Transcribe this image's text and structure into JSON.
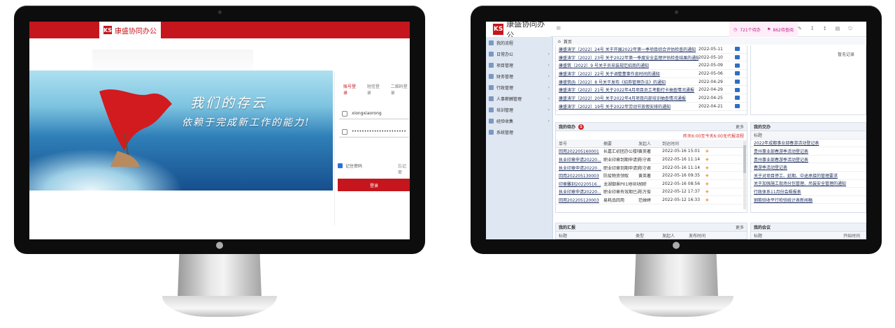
{
  "brand": {
    "name": "康盛协同办公",
    "mark": "KS"
  },
  "login": {
    "slogan1": "我们的存云",
    "slogan2": "依赖于完成新工作的能力!",
    "tabs": [
      "账号登录",
      "短信登录",
      "二维码登录"
    ],
    "username": "xiongxiaorong",
    "password_mask": "••••••••••••••••••••••",
    "remember": "记住密码",
    "forgot": "忘记密",
    "login_button": "登录"
  },
  "dashboard": {
    "header": {
      "menu_toggle": "≡",
      "todo_count": "721个待办",
      "unread_count": "862待查阅"
    },
    "sidebar": [
      {
        "label": "我的流程"
      },
      {
        "label": "日常办公"
      },
      {
        "label": "项目管理"
      },
      {
        "label": "财务管理"
      },
      {
        "label": "行政管理"
      },
      {
        "label": "人事薪酬管理"
      },
      {
        "label": "培训管理"
      },
      {
        "label": "经验收集"
      },
      {
        "label": "系统管理"
      }
    ],
    "breadcrumb": "首页",
    "notices": [
      {
        "title": "康盛涛字〔2022〕24号 关于开展2022年第一季项目综合评估检查的通知",
        "date": "2022-05-11"
      },
      {
        "title": "康盛涛字〔2022〕23号 关于2022年第一季度安全监理评估检查结果的通知",
        "date": "2022-05-10"
      },
      {
        "title": "康盛筑〔2022〕9 号关于员采装规范招商的通知",
        "date": "2022-05-09"
      },
      {
        "title": "康盛涛字〔2022〕22号 关于调整董事作息时间的通知",
        "date": "2022-05-06"
      },
      {
        "title": "康盛筑函〔2022〕8 号关于发布《招券管理办法》的通知",
        "date": "2022-04-29"
      },
      {
        "title": "康盛涛字〔2022〕21号 关于2022年4月项目员工考勤打卡抽查情况通报",
        "date": "2022-04-29"
      },
      {
        "title": "康盛涛字〔2022〕20号 关于2022年4月项目内部培训抽查情况通报",
        "date": "2022-04-25"
      },
      {
        "title": "康盛涛字〔2022〕19号 关于2022年劳动节放假安排的通知",
        "date": "2022-04-21"
      }
    ],
    "right_top_empty": "暂无记录",
    "todo": {
      "title": "我的待办",
      "badge": "1",
      "more": "更多",
      "warning": "昨天6:00至今天6:00无代报流程",
      "headers": [
        "单号",
        "摘要",
        "发起人",
        "到达时间"
      ],
      "rows": [
        {
          "no": "回用202205160001",
          "summary": "长嘉汇初团办公楼检回用",
          "user": "黄英著",
          "time": "2022-05-16 15:01"
        },
        {
          "no": "执业印章申请20220...",
          "summary": "职业印章到期申请更换",
          "user": "陈守君",
          "time": "2022-05-16 11:14"
        },
        {
          "no": "执业印章申请20220...",
          "summary": "职业印章到期申请更换",
          "user": "陈守君",
          "time": "2022-05-16 11:14"
        },
        {
          "no": "回用202205130003",
          "summary": "防疫物资领取",
          "user": "黄英著",
          "time": "2022-05-16 09:35"
        },
        {
          "no": "印章雕刻20220516...",
          "summary": "龙湖御景P01地块项目...",
          "user": "胡昕",
          "time": "2022-05-16 08:56"
        },
        {
          "no": "执业印章申请20220...",
          "summary": "职业印章有效期已过，...",
          "user": "陈万俊",
          "time": "2022-05-12 17:37"
        },
        {
          "no": "回用202205120003",
          "summary": "易耗品回用",
          "user": "范婵婷",
          "time": "2022-05-12 16:33"
        }
      ]
    },
    "delivery": {
      "title": "我的交办",
      "header": "标题",
      "rows": [
        "2022年成都事业部春游活动登记表",
        "贵州事业部春游季活动登记表",
        "贵州事业部春游季活动登记表",
        "春游季活动登记表",
        "关于对项目停工、延期、中途承接的管理要求",
        "关于加强施工现场分包管理、吊装安全管理的通知",
        "行政体系11月份会晤报表",
        "钢筋验收平行检验统计表新闻稿"
      ]
    },
    "report": {
      "title": "我的汇报",
      "more": "更多",
      "headers": [
        "标题",
        "类型",
        "发起人",
        "发布时间"
      ]
    },
    "meeting": {
      "title": "我的会议",
      "headers": [
        "标题",
        "开始时间"
      ]
    }
  }
}
